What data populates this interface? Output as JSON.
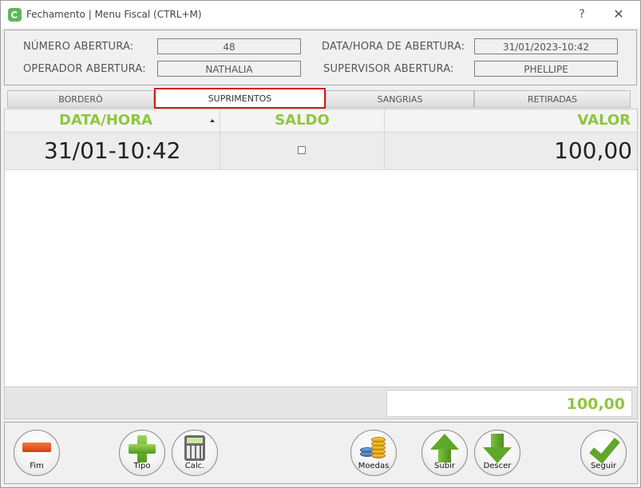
{
  "window": {
    "title": "Fechamento | Menu Fiscal (CTRL+M)",
    "help_glyph": "?",
    "close_glyph": "✕"
  },
  "info": {
    "numero_label": "NÚMERO ABERTURA:",
    "numero_value": "48",
    "datahora_label": "DATA/HORA DE ABERTURA:",
    "datahora_value": "31/01/2023-10:42",
    "operador_label": "OPERADOR ABERTURA:",
    "operador_value": "NATHALIA",
    "supervisor_label": "SUPERVISOR ABERTURA:",
    "supervisor_value": "PHELLIPE"
  },
  "tabs": [
    {
      "label": "BORDERÔ"
    },
    {
      "label": "SUPRIMENTOS",
      "active": true
    },
    {
      "label": "SANGRIAS"
    },
    {
      "label": "RETIRADAS"
    }
  ],
  "grid": {
    "columns": [
      "DATA/HORA",
      "SALDO",
      "VALOR"
    ],
    "rows": [
      {
        "datahora": "31/01-10:42",
        "saldo_checked": false,
        "valor": "100,00"
      }
    ],
    "total": "100,00"
  },
  "buttons": {
    "fim": "Fim",
    "tipo": "Tipo",
    "calc": "Calc.",
    "moedas": "Moedas",
    "subir": "Subir",
    "descer": "Descer",
    "seguir": "Seguir"
  },
  "colors": {
    "accent_green": "#8ec63f",
    "active_tab_border": "#d01c1c",
    "minus_orange": "#e55a1e"
  }
}
